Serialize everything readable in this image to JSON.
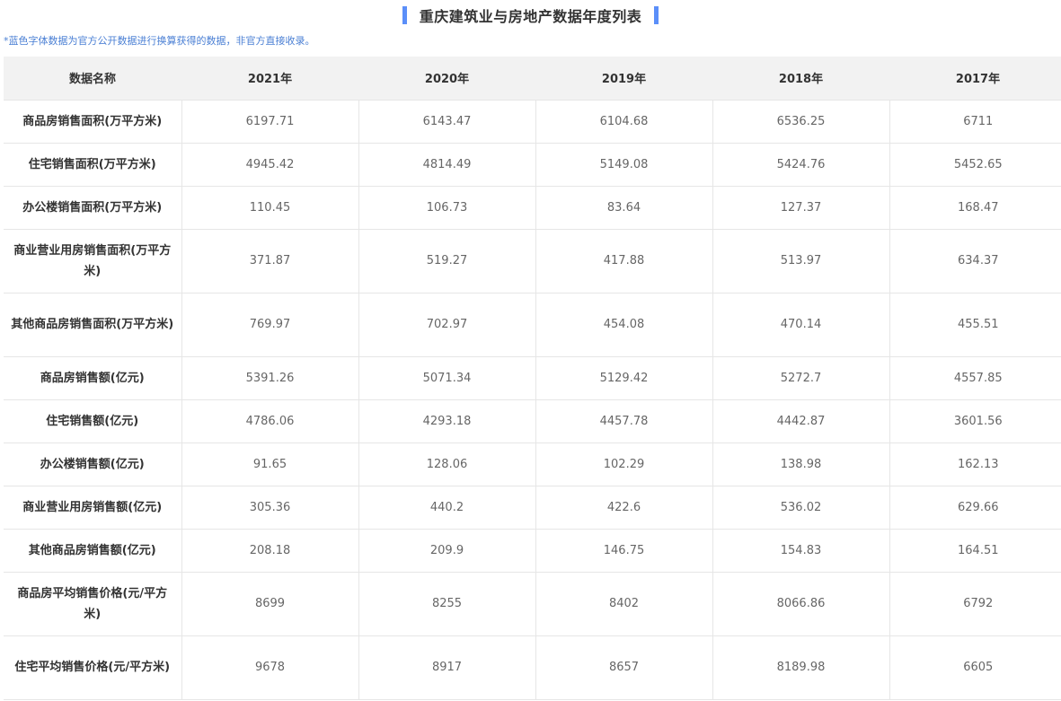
{
  "title": "重庆建筑业与房地产数据年度列表",
  "note": "*蓝色字体数据为官方公开数据进行换算获得的数据，非官方直接收录。",
  "colors": {
    "accent": "#5b8ff9",
    "note": "#4a7fd4",
    "header_bg": "#f2f2f2"
  },
  "table": {
    "headers": [
      "数据名称",
      "2021年",
      "2020年",
      "2019年",
      "2018年",
      "2017年"
    ],
    "rows": [
      {
        "name": "商品房销售面积(万平方米)",
        "values": [
          "6197.71",
          "6143.47",
          "6104.68",
          "6536.25",
          "6711"
        ]
      },
      {
        "name": "住宅销售面积(万平方米)",
        "values": [
          "4945.42",
          "4814.49",
          "5149.08",
          "5424.76",
          "5452.65"
        ]
      },
      {
        "name": "办公楼销售面积(万平方米)",
        "values": [
          "110.45",
          "106.73",
          "83.64",
          "127.37",
          "168.47"
        ]
      },
      {
        "name": "商业营业用房销售面积(万平方米)",
        "values": [
          "371.87",
          "519.27",
          "417.88",
          "513.97",
          "634.37"
        ]
      },
      {
        "name": "其他商品房销售面积(万平方米)",
        "values": [
          "769.97",
          "702.97",
          "454.08",
          "470.14",
          "455.51"
        ]
      },
      {
        "name": "商品房销售额(亿元)",
        "values": [
          "5391.26",
          "5071.34",
          "5129.42",
          "5272.7",
          "4557.85"
        ]
      },
      {
        "name": "住宅销售额(亿元)",
        "values": [
          "4786.06",
          "4293.18",
          "4457.78",
          "4442.87",
          "3601.56"
        ]
      },
      {
        "name": "办公楼销售额(亿元)",
        "values": [
          "91.65",
          "128.06",
          "102.29",
          "138.98",
          "162.13"
        ]
      },
      {
        "name": "商业营业用房销售额(亿元)",
        "values": [
          "305.36",
          "440.2",
          "422.6",
          "536.02",
          "629.66"
        ]
      },
      {
        "name": "其他商品房销售额(亿元)",
        "values": [
          "208.18",
          "209.9",
          "146.75",
          "154.83",
          "164.51"
        ]
      },
      {
        "name": "商品房平均销售价格(元/平方米)",
        "values": [
          "8699",
          "8255",
          "8402",
          "8066.86",
          "6792"
        ]
      },
      {
        "name": "住宅平均销售价格(元/平方米)",
        "values": [
          "9678",
          "8917",
          "8657",
          "8189.98",
          "6605"
        ]
      }
    ]
  }
}
